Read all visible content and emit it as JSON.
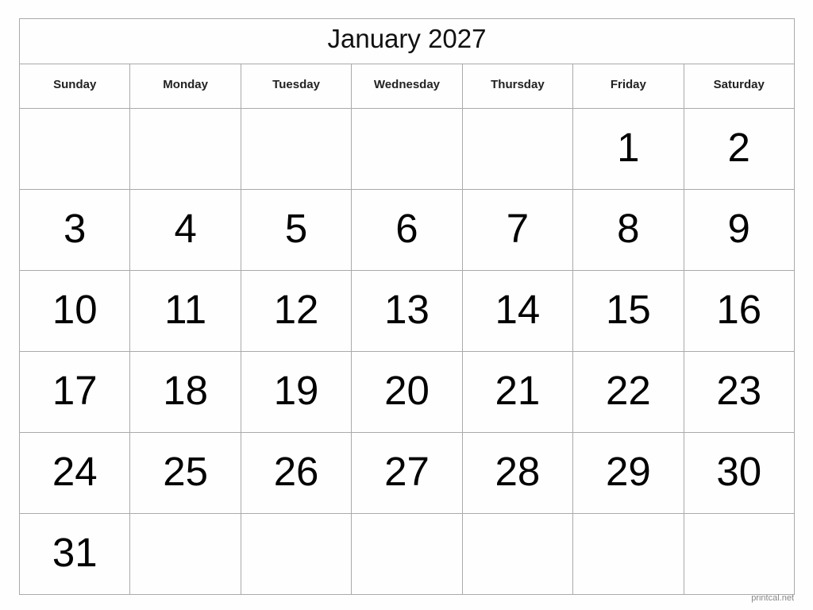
{
  "title": "January 2027",
  "weekdays": [
    "Sunday",
    "Monday",
    "Tuesday",
    "Wednesday",
    "Thursday",
    "Friday",
    "Saturday"
  ],
  "weeks": [
    [
      "",
      "",
      "",
      "",
      "",
      "1",
      "2"
    ],
    [
      "3",
      "4",
      "5",
      "6",
      "7",
      "8",
      "9"
    ],
    [
      "10",
      "11",
      "12",
      "13",
      "14",
      "15",
      "16"
    ],
    [
      "17",
      "18",
      "19",
      "20",
      "21",
      "22",
      "23"
    ],
    [
      "24",
      "25",
      "26",
      "27",
      "28",
      "29",
      "30"
    ],
    [
      "31",
      "",
      "",
      "",
      "",
      "",
      ""
    ]
  ],
  "credit": "printcal.net"
}
